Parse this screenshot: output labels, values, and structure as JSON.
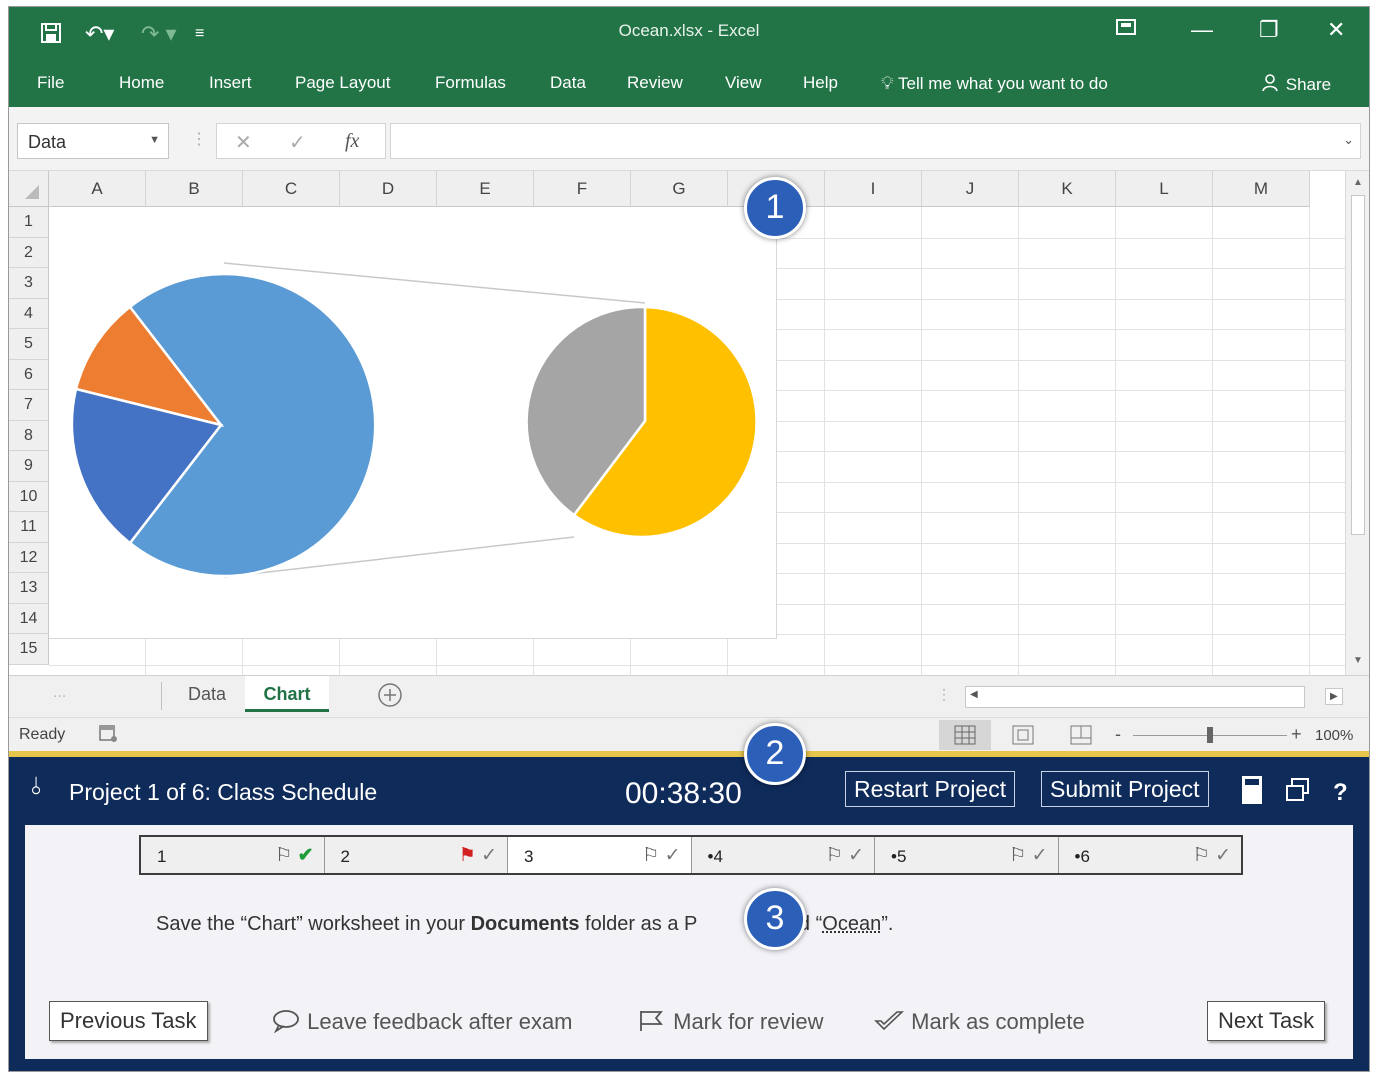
{
  "window": {
    "title": "Ocean.xlsx - Excel",
    "share": "Share",
    "tell_me": "Tell me what you want to do"
  },
  "ribbon": {
    "tabs": [
      "File",
      "Home",
      "Insert",
      "Page Layout",
      "Formulas",
      "Data",
      "Review",
      "View",
      "Help"
    ]
  },
  "formula_bar": {
    "name_box": "Data",
    "fx": "fx"
  },
  "grid": {
    "columns": [
      "A",
      "B",
      "C",
      "D",
      "E",
      "F",
      "G",
      "H",
      "I",
      "J",
      "K",
      "L",
      "M"
    ],
    "rows": [
      "1",
      "2",
      "3",
      "4",
      "5",
      "6",
      "7",
      "8",
      "9",
      "10",
      "11",
      "12",
      "13",
      "14",
      "15"
    ]
  },
  "chart": {
    "type": "pie-of-pie",
    "main_colors": [
      "#5b9bd5",
      "#ed7d31",
      "#4472c4"
    ],
    "secondary_colors": [
      "#ffc000",
      "#a5a5a5"
    ]
  },
  "sheets": {
    "tabs": [
      "Data",
      "Chart"
    ],
    "active": "Chart",
    "ellipsis": "..."
  },
  "status": {
    "ready": "Ready",
    "zoom": "100%",
    "zoom_level": 1.0
  },
  "exam": {
    "project_title": "Project 1 of 6: Class Schedule",
    "timer": "00:38:30",
    "restart_label": "Restart Project",
    "submit_label": "Submit Project",
    "help_label": "?",
    "tasks": [
      {
        "label": "1",
        "flag": "outline",
        "check": "green"
      },
      {
        "label": "2",
        "flag": "red",
        "check": "outline"
      },
      {
        "label": "3",
        "flag": "outline",
        "check": "outline"
      },
      {
        "label": "•4",
        "flag": "outline",
        "check": "outline"
      },
      {
        "label": "•5",
        "flag": "outline",
        "check": "outline"
      },
      {
        "label": "•6",
        "flag": "outline",
        "check": "outline"
      }
    ],
    "instruction_pre": "Save the “Chart” worksheet in your ",
    "instruction_bold": "Documents",
    "instruction_mid": " folder as a P",
    "instruction_after": " named “",
    "instruction_filename": "Ocean",
    "instruction_end": "”.",
    "previous_label": "Previous Task",
    "feedback_label": "Leave feedback after exam",
    "review_label": "Mark for review",
    "complete_label": "Mark as complete",
    "next_label": "Next Task"
  },
  "callouts": [
    "1",
    "2",
    "3"
  ]
}
